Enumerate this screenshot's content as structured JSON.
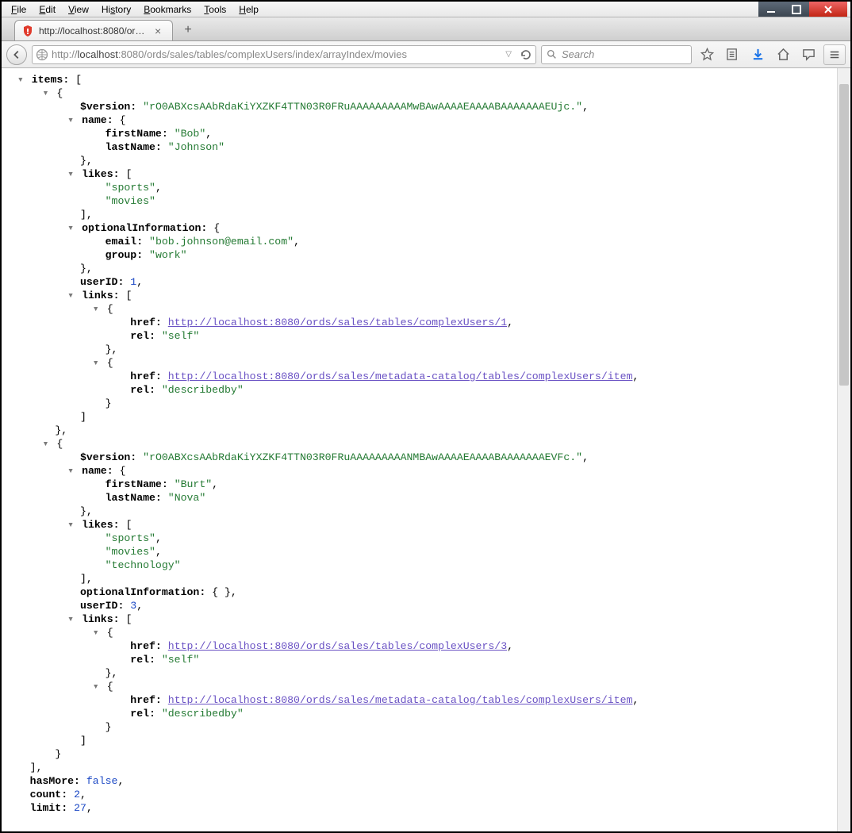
{
  "menu": {
    "file": "File",
    "edit": "Edit",
    "view": "View",
    "history": "History",
    "bookmarks": "Bookmarks",
    "tools": "Tools",
    "help": "Help"
  },
  "tab": {
    "title": "http://localhost:8080/ords/..."
  },
  "url": {
    "prefix": "http://",
    "host": "localhost",
    "port": ":8080",
    "path": "/ords/sales/tables/complexUsers/index/arrayIndex/movies"
  },
  "search": {
    "placeholder": "Search"
  },
  "response": {
    "items": [
      {
        "$version": "rO0ABXcsAAbRdaKiYXZKF4TTN03R0FRuAAAAAAAAAMwBAwAAAAEAAAABAAAAAAAEUjc.",
        "name": {
          "firstName": "Bob",
          "lastName": "Johnson"
        },
        "likes": [
          "sports",
          "movies"
        ],
        "optionalInformation": {
          "email": "bob.johnson@email.com",
          "group": "work"
        },
        "userID": 1,
        "links": [
          {
            "href": "http://localhost:8080/ords/sales/tables/complexUsers/1",
            "rel": "self"
          },
          {
            "href": "http://localhost:8080/ords/sales/metadata-catalog/tables/complexUsers/item",
            "rel": "describedby"
          }
        ]
      },
      {
        "$version": "rO0ABXcsAAbRdaKiYXZKF4TTN03R0FRuAAAAAAAAANMBAwAAAAEAAAABAAAAAAAEVFc.",
        "name": {
          "firstName": "Burt",
          "lastName": "Nova"
        },
        "likes": [
          "sports",
          "movies",
          "technology"
        ],
        "optionalInformation": {},
        "userID": 3,
        "links": [
          {
            "href": "http://localhost:8080/ords/sales/tables/complexUsers/3",
            "rel": "self"
          },
          {
            "href": "http://localhost:8080/ords/sales/metadata-catalog/tables/complexUsers/item",
            "rel": "describedby"
          }
        ]
      }
    ],
    "hasMore": false,
    "count": 2,
    "limit": 27
  }
}
